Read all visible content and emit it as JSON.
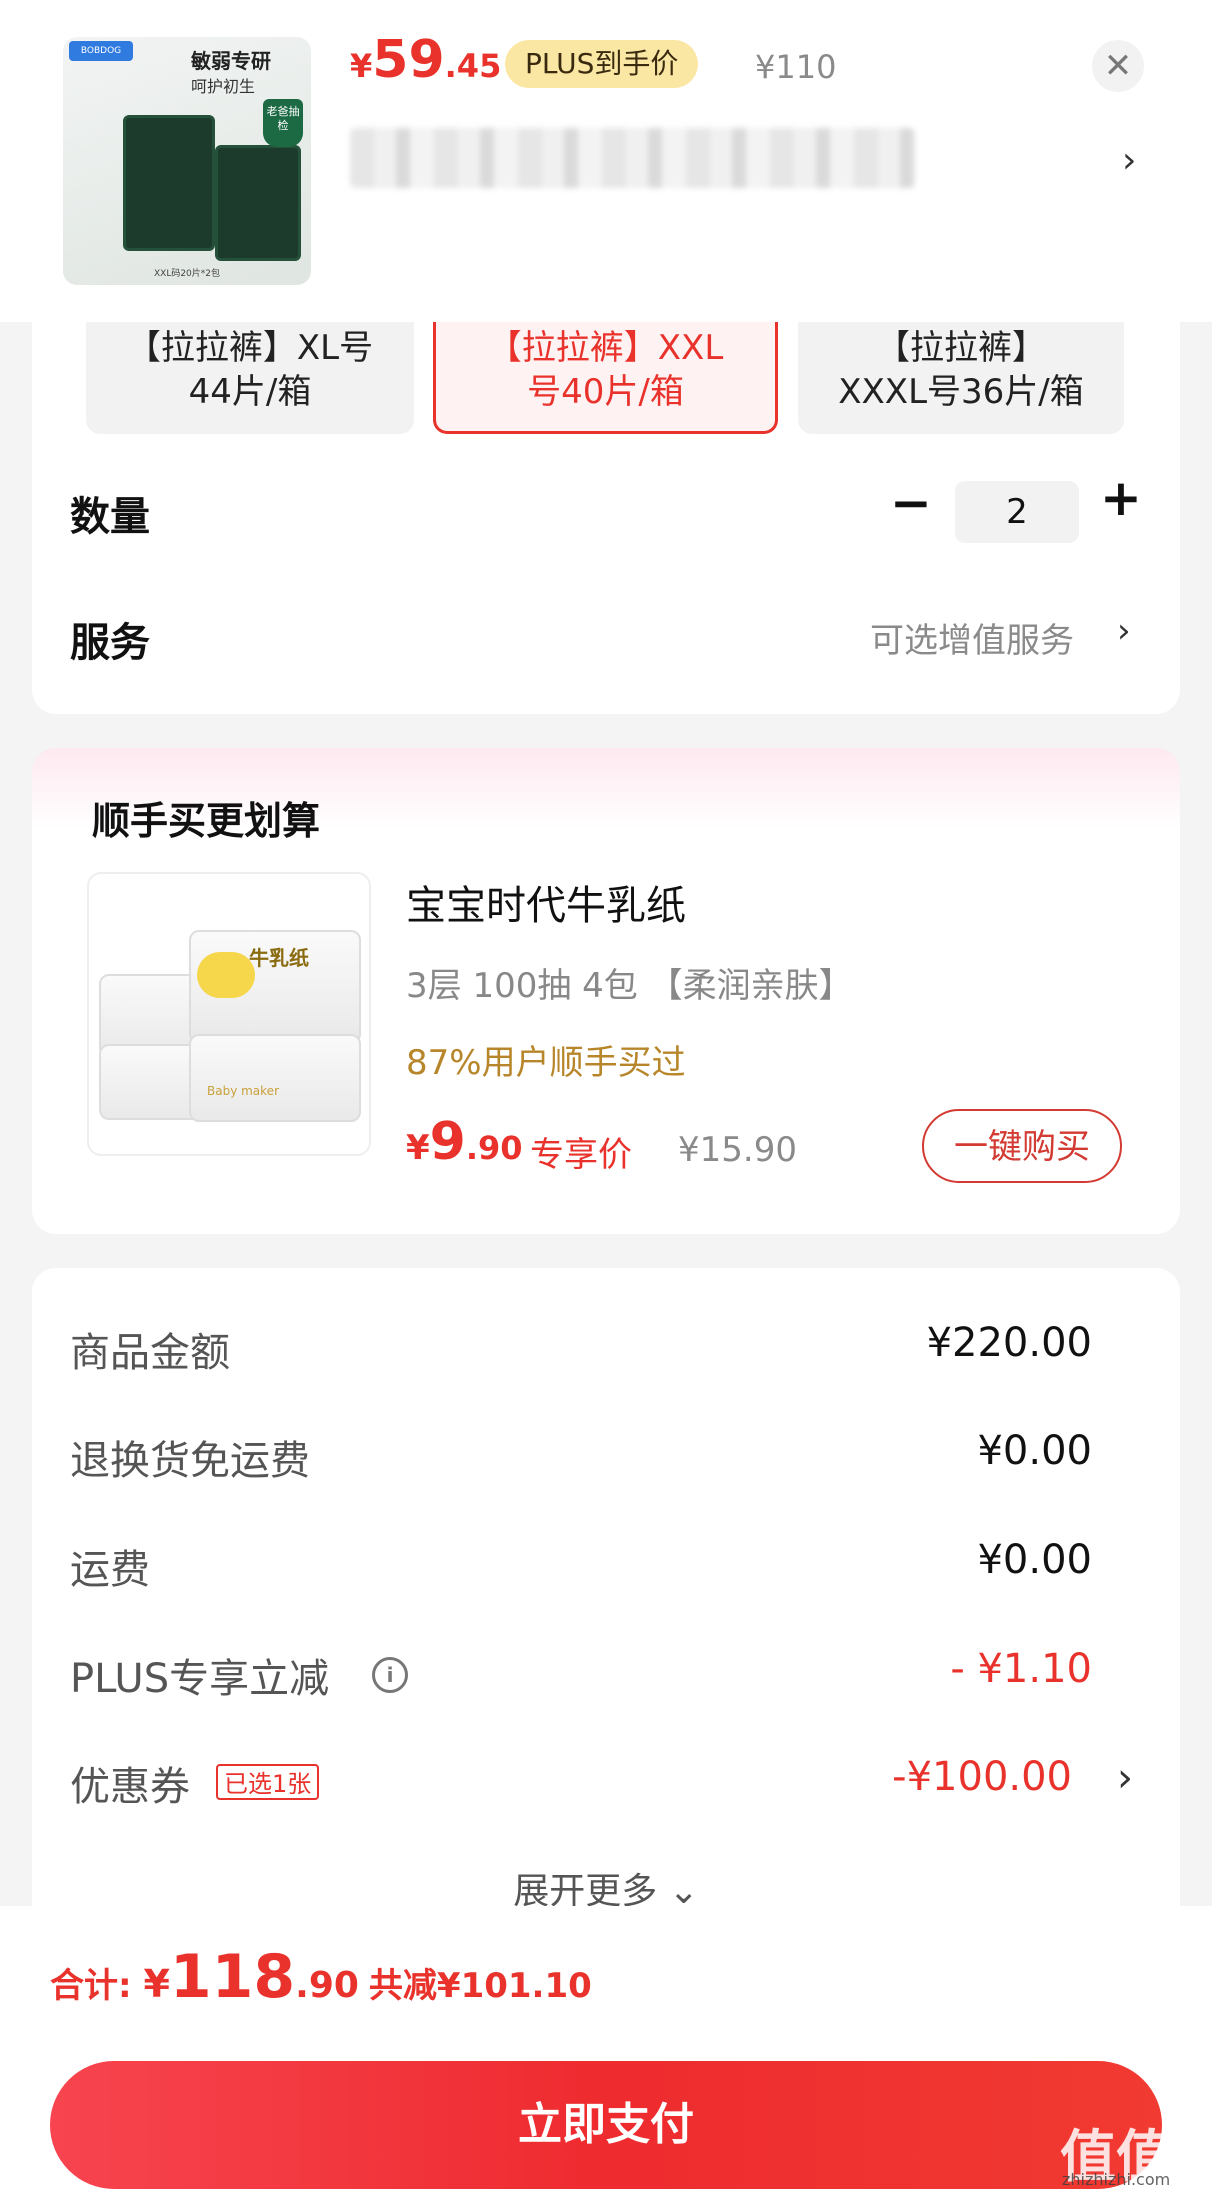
{
  "header": {
    "product_thumb": {
      "brand_chip": "BOBDOG",
      "tagline_1": "敏弱专研",
      "tagline_2": "呵护初生",
      "shield_text": "老爸抽检",
      "caption": "XXL码20片*2包"
    },
    "price": {
      "symbol": "¥",
      "integer": "59",
      "decimal": ".45"
    },
    "plus_badge": "PLUS到手价",
    "original_price": "¥110",
    "close_icon": "close-icon",
    "more_icon": "chevron-right-icon"
  },
  "specs": [
    {
      "line1": "【拉拉裤】XL号",
      "line2": "44片/箱",
      "selected": false
    },
    {
      "line1": "【拉拉裤】XXL",
      "line2": "号40片/箱",
      "selected": true
    },
    {
      "line1": "【拉拉裤】",
      "line2": "XXXL号36片/箱",
      "selected": false
    }
  ],
  "quantity": {
    "label": "数量",
    "value": "2",
    "minus": "−",
    "plus": "+"
  },
  "service": {
    "label": "服务",
    "value": "可选增值服务",
    "chevron": "›"
  },
  "addon": {
    "title": "顺手买更划算",
    "product": {
      "name": "宝宝时代牛乳纸",
      "spec": "3层 100抽 4包 【柔润亲肤】",
      "stat": "87%用户顺手买过",
      "price": {
        "symbol": "¥",
        "integer": "9",
        "decimal": ".90"
      },
      "price_tag": "专享价",
      "original_price": "¥15.90",
      "buy_button": "一键购买",
      "image_text": "牛乳纸",
      "image_brand": "Baby maker"
    }
  },
  "amounts": {
    "rows": [
      {
        "label": "商品金额",
        "value": "¥220.00",
        "red": false
      },
      {
        "label": "退换货免运费",
        "value": "¥0.00",
        "red": false
      },
      {
        "label": "运费",
        "value": "¥0.00",
        "red": false
      },
      {
        "label": "PLUS专享立减",
        "value": "- ¥1.10",
        "red": true
      },
      {
        "label": "优惠券",
        "value": "-¥100.00",
        "red": true
      }
    ],
    "coupon_tag": "已选1张",
    "info_icon": "i",
    "expand_more": "展开更多 ⌄"
  },
  "footer": {
    "total_label": "合计: ",
    "total": {
      "symbol": "¥",
      "integer": "118",
      "decimal": ".90"
    },
    "saved": "共减¥101.10",
    "pay_button": "立即支付"
  },
  "watermark": {
    "text": "值值值",
    "url": "zhizhizhi.com"
  },
  "colors": {
    "accent": "#e8322b",
    "plus_badge": "#fbe7a4",
    "gold_text": "#b8862a",
    "page_bg": "#f4f4f4"
  }
}
